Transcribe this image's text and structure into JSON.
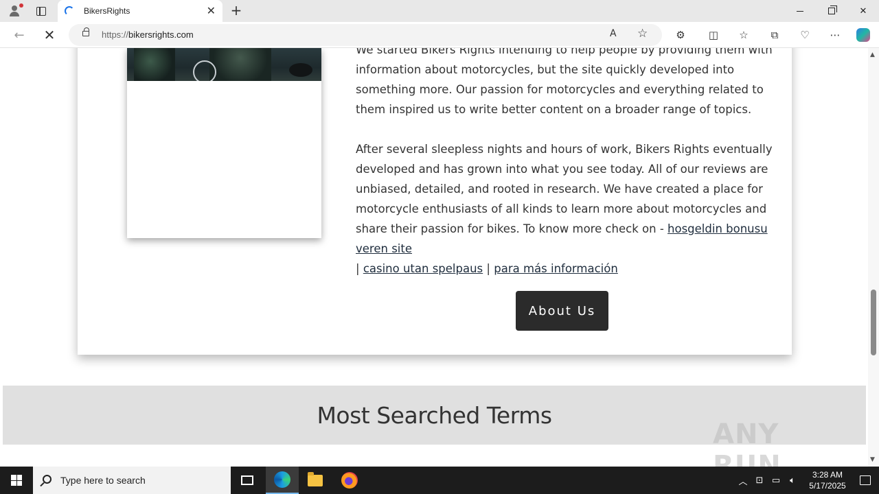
{
  "browser": {
    "tab_title": "BikersRights",
    "url_prefix": "https://",
    "url_host": "bikersrights.com"
  },
  "page": {
    "paragraph1": "We started Bikers Rights intending to help people by providing them with information about motorcycles, but the site quickly developed into something more. Our passion for motorcycles and everything related to them inspired us to write better content on a broader range of topics.",
    "paragraph2_text": "After several sleepless nights and hours of work, Bikers Rights eventually developed and has grown into what you see today. All of our reviews are unbiased, detailed, and rooted in research. We have created a place for motorcycle enthusiasts of all kinds to learn more about motorcycles and share their passion for bikes. To know more check on - ",
    "links": [
      "hosgeldin bonusu veren site",
      "casino utan spelpaus",
      "para más información"
    ],
    "separator": "|",
    "about_button": "About Us",
    "section_title": "Most Searched Terms"
  },
  "watermark": "ANY RUN",
  "taskbar": {
    "search_placeholder": "Type here to search",
    "time": "3:28 AM",
    "date": "5/17/2025"
  }
}
